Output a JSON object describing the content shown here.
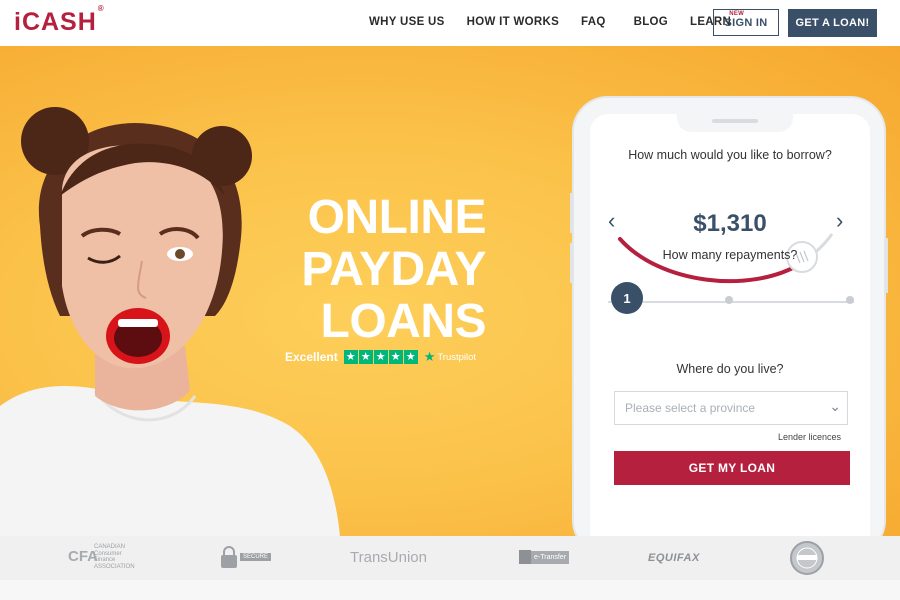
{
  "header": {
    "logo": "iCASH",
    "logo_mark": "®",
    "nav": [
      {
        "label": "WHY USE US"
      },
      {
        "label": "HOW IT WORKS"
      },
      {
        "label": "FAQ"
      },
      {
        "label": "BLOG"
      },
      {
        "label": "LEARN",
        "badge": "NEW"
      }
    ],
    "sign_in": "SIGN IN",
    "get_loan": "GET A LOAN!"
  },
  "hero": {
    "headline": [
      "ONLINE",
      "PAYDAY",
      "LOANS"
    ],
    "trust_rating": "Excellent",
    "trust_brand": "Trustpilot",
    "star_count": 5
  },
  "calculator": {
    "borrow_question": "How much would you like to borrow?",
    "amount": "$1,310",
    "repayments_question": "How many repayments?",
    "repayments_value": "1",
    "province_question": "Where do you live?",
    "province_placeholder": "Please select a province",
    "lender_link": "Lender licences",
    "cta": "GET MY LOAN"
  },
  "partners": {
    "cfsa_lines": [
      "CANADIAN",
      "Consumer",
      "Finance",
      "ASSOCIATION"
    ],
    "cfsa_initials": "CFA",
    "secure_label": "SECURE",
    "transunion": "TransUnion",
    "etransfer": "e-Transfer",
    "equifax": "EQUIFAX"
  },
  "colors": {
    "brand_red": "#b5203f",
    "navy": "#3a4f68",
    "trust_green": "#00b67a",
    "hero_yellow": "#fbc24a"
  }
}
